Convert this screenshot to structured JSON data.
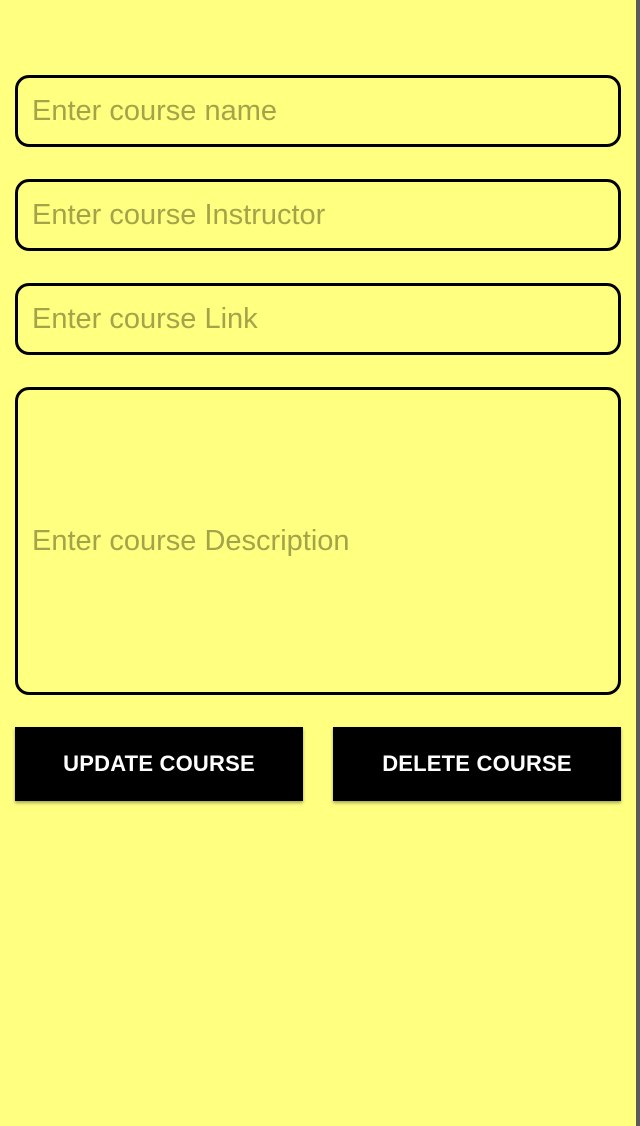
{
  "form": {
    "course_name": {
      "value": "",
      "placeholder": "Enter course name"
    },
    "course_instructor": {
      "value": "",
      "placeholder": "Enter course Instructor"
    },
    "course_link": {
      "value": "",
      "placeholder": "Enter course Link"
    },
    "course_description": {
      "value": "",
      "placeholder": "Enter course Description"
    }
  },
  "actions": {
    "update_label": "UPDATE COURSE",
    "delete_label": "DELETE COURSE"
  },
  "colors": {
    "background": "#ffff80",
    "field_border": "#000000",
    "placeholder": "#a3a349",
    "button_background": "#000000",
    "button_text": "#ffffff"
  }
}
